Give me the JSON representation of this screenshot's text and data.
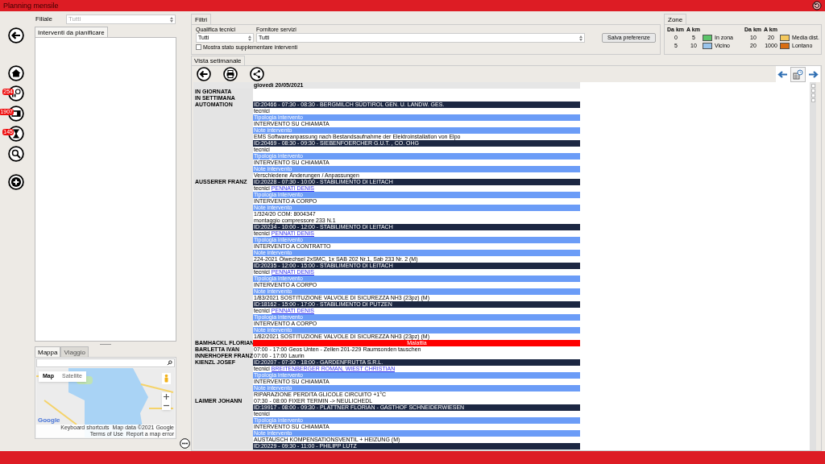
{
  "window": {
    "title": "Planning mensile"
  },
  "nav": [
    {
      "kind": "back"
    },
    {
      "kind": "home"
    },
    {
      "kind": "chart",
      "badge": "254"
    },
    {
      "kind": "card",
      "badge": "1907"
    },
    {
      "kind": "hourglass",
      "badge": "145"
    },
    {
      "kind": "search"
    },
    {
      "kind": "add"
    }
  ],
  "left_panel": {
    "branch_label": "Filiale",
    "branch_value": "Tutti",
    "branch_disabled": true,
    "tabs": [
      {
        "label": "Interventi da pianificare",
        "selected": true
      }
    ],
    "map_tabs": [
      {
        "label": "Mappa",
        "selected": true
      },
      {
        "label": "Viaggio",
        "selected": false
      }
    ],
    "map_types": [
      {
        "label": "Map",
        "selected": true
      },
      {
        "label": "Satellite",
        "selected": false
      }
    ],
    "map_footer": [
      "Keyboard shortcuts",
      "Map data ©2021 Google",
      "Terms of Use",
      "Report a map error"
    ],
    "map_logo": "Google"
  },
  "filters": {
    "tab": "Filtri",
    "fields": [
      {
        "label": "Qualifica tecnici",
        "value": "Tutti"
      },
      {
        "label": "Fornitore servizi",
        "value": "Tutti"
      }
    ],
    "checkbox": {
      "label": "Mostra stato supplementare interventi",
      "checked": false
    },
    "save_button": "Salva preferenze"
  },
  "zones": {
    "title": "Zone",
    "columns": [
      {
        "from": "Da km",
        "to": "A km"
      },
      {
        "from": "Da km",
        "to": "A km"
      }
    ],
    "items": [
      {
        "from": "0",
        "to": "5",
        "label": "In zona",
        "color": "#5cc46a"
      },
      {
        "from": "5",
        "to": "10",
        "label": "Vicino",
        "color": "#99c4ec"
      },
      {
        "from": "10",
        "to": "20",
        "label": "Media dist.",
        "color": "#f4c85c"
      },
      {
        "from": "20",
        "to": "1000",
        "label": "Lontano",
        "color": "#d96d12"
      }
    ]
  },
  "schedule": {
    "tab": "Vista setimanale",
    "day": "giovedì 20/05/2021",
    "rows": [
      {
        "name": "IN GIORNATA",
        "items": []
      },
      {
        "name": "IN SETTIMANA",
        "items": []
      },
      {
        "name": "AUTOMATION",
        "items": [
          {
            "kind": "appointment",
            "header": "ID:20466 - 07:30 - 08:30 - BERGMILCH SÜDTIROL GEN. U. LANDW. GES.",
            "tecnici_label": "tecnici",
            "type_label": "Tipologia intervento",
            "type": "INTERVENTO SU CHIAMATA",
            "notes_label": "Note intervento",
            "notes": [
              "EMS Softwareanpassung nach Bestandsaufnahme der Elektroinstallation von Elpo"
            ]
          },
          {
            "kind": "appointment",
            "header": "ID:20469 - 08:30 - 09:30 - SIEBENFOERCHER G.U.T. , CO. OHG",
            "tecnici_label": "tecnici",
            "type_label": "Tipologia intervento",
            "type": "INTERVENTO SU CHIAMATA",
            "notes_label": "Note intervento",
            "notes": [
              "Verschiedene Änderungen / Anpassungen"
            ]
          }
        ]
      },
      {
        "name": "AUSSERER FRANZ",
        "items": [
          {
            "kind": "appointment",
            "header": "ID:20228 - 07:30 - 10:00 - STABILIMENTO DI LEITACH",
            "tecnici_label": "tecnici",
            "technicians": "PENNATI DENIS",
            "type_label": "Tipologia intervento",
            "type": "INTERVENTO A CORPO",
            "notes_label": "Note intervento",
            "notes": [
              "1/324/20 COM: 8004347",
              "montaggio compressore 233 N.1"
            ]
          },
          {
            "kind": "appointment",
            "header": "ID:20234 - 10:00 - 12:00 - STABILIMENTO DI LEITACH",
            "tecnici_label": "tecnici",
            "technicians": "PENNATI DENIS",
            "type_label": "Tipologia intervento",
            "type": "INTERVENTO A CONTRATTO",
            "notes_label": "Note intervento",
            "notes": [
              "224-2021 Ölwechsel 2xSMC, 1x SAB 202 Nr.1, Sab 233 Nr. 2 (M)"
            ]
          },
          {
            "kind": "appointment",
            "header": "ID:20235 - 12:00 - 15:00 - STABILIMENTO DI LEITACH",
            "tecnici_label": "tecnici",
            "technicians": "PENNATI DENIS",
            "type_label": "Tipologia intervento",
            "type": "INTERVENTO A CORPO",
            "notes_label": "Note intervento",
            "notes": [
              "1/83/2021 SOSTITUZIONE VALVOLE DI SICUREZZA NH3 (23pz) (M)"
            ]
          },
          {
            "kind": "appointment",
            "header": "ID:18162 - 15:00 - 17:00 - STABILIMENTO DI PUTZEN",
            "tecnici_label": "tecnici",
            "technicians": "PENNATI DENIS",
            "type_label": "Tipologia intervento",
            "type": "INTERVENTO A CORPO",
            "notes_label": "Note intervento",
            "notes": [
              "1/82/2021 SOSTITUZIONE VALVOLE DI SICUREZZA NH3 (23pz) (M)"
            ]
          }
        ]
      },
      {
        "name": "BAMHACKL FLORIAN",
        "items": [
          {
            "kind": "absence",
            "text": "Malattia"
          }
        ]
      },
      {
        "name": "BARLETTA IVAN",
        "items": [
          {
            "kind": "plain",
            "text": "07:00 - 17:00 Geos Unten - Zellen 201-229 Raumsonden tauschen"
          }
        ]
      },
      {
        "name": "INNERHOFER FRANZ",
        "items": [
          {
            "kind": "plain",
            "text": "07:00 - 17:00 Laurin"
          }
        ]
      },
      {
        "name": "KIENZL JOSEF",
        "items": [
          {
            "kind": "appointment",
            "header": "ID:20207 - 07:30 - 18:00 - GARDENFRUTTA S.R.L.",
            "tecnici_label": "tecnici",
            "technicians": "BREITENBERGER ROMAN, WIEST CHRISTIAN",
            "type_label": "Tipologia intervento",
            "type": "INTERVENTO SU CHIAMATA",
            "notes_label": "Note intervento",
            "notes": [
              "RIPARAZIONE PERDITA GLICOLE CIRCUITO +1°C"
            ]
          }
        ]
      },
      {
        "name": "LAIMER JOHANN",
        "items": [
          {
            "kind": "plain",
            "text": "07:30 - 08:00 FIXER TERMIN -> NEULICHEDL"
          },
          {
            "kind": "appointment",
            "header": "ID:19917 - 08:00 - 09:30 - PLATTNER FLORIAN - GASTHOF SCHNEIDERWIESEN",
            "tecnici_label": "tecnici",
            "type_label": "Tipologia intervento",
            "type": "INTERVENTO SU CHIAMATA",
            "notes_label": "Note intervento",
            "notes": [
              "AUSTAUSCH KOMPENSATIONSVENTIL + HEIZUNG (M)"
            ]
          },
          {
            "kind": "appointment",
            "header": "ID:20229 - 09:30 - 11:00 - PHILIPP LUTZ"
          }
        ]
      }
    ]
  }
}
